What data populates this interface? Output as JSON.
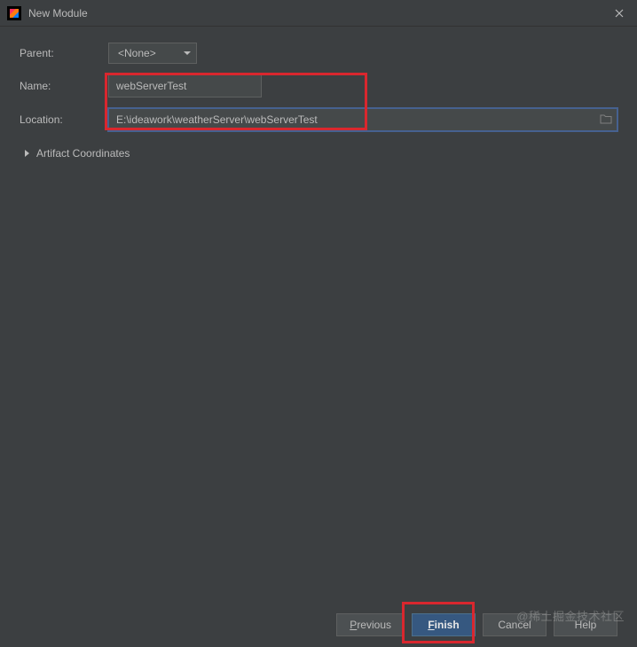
{
  "titlebar": {
    "title": "New Module"
  },
  "form": {
    "parent": {
      "label": "Parent:",
      "value": "<None>"
    },
    "name": {
      "label": "Name:",
      "value": "webServerTest"
    },
    "location": {
      "label": "Location:",
      "value": "E:\\ideawork\\weatherServer\\webServerTest"
    },
    "artifact": {
      "label": "Artifact Coordinates"
    }
  },
  "buttons": {
    "previous": {
      "mnemonic": "P",
      "rest": "revious"
    },
    "finish": {
      "mnemonic": "F",
      "rest": "inish"
    },
    "cancel": "Cancel",
    "help": "Help"
  },
  "watermark": "@稀土掘金技术社区"
}
